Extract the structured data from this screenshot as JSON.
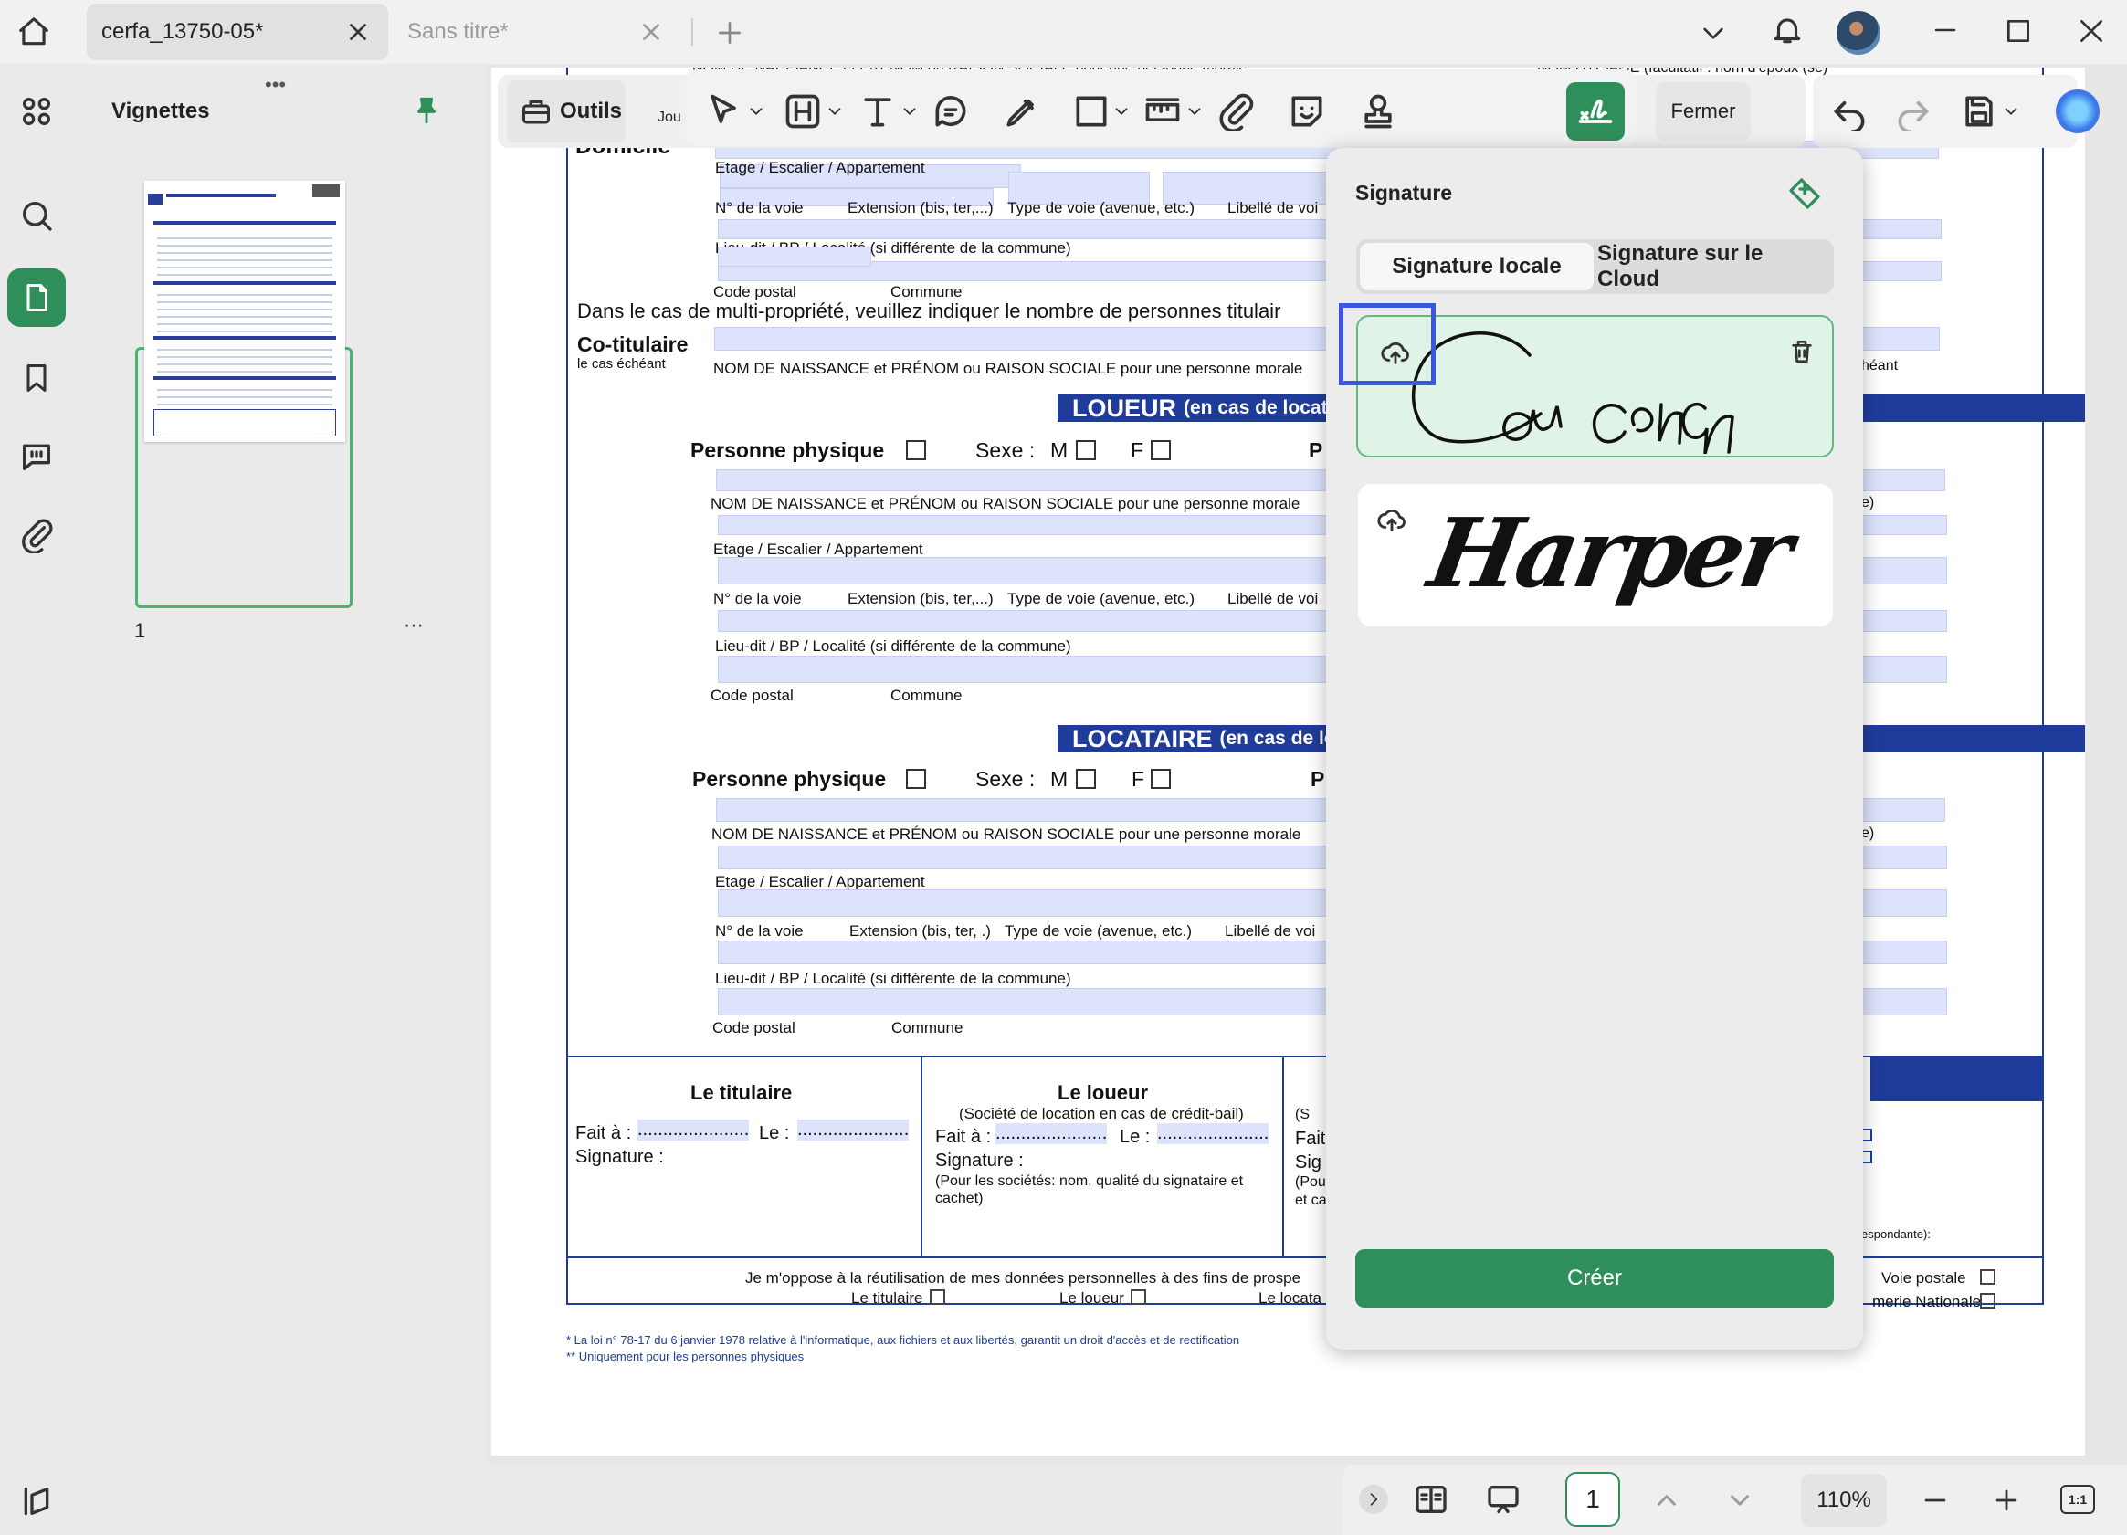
{
  "tabs": [
    {
      "label": "cerfa_13750-05*"
    },
    {
      "label": "Sans titre*"
    }
  ],
  "left_panel": {
    "title": "Vignettes",
    "page_number": "1"
  },
  "toolbar": {
    "tools_label": "Outils",
    "close_label": "Fermer",
    "hidden_word": "Jou"
  },
  "form": {
    "top_line_left": "NOM DE NAISSANCE et PRÉNOM ou RAISON SOCIALE pour une personne morale",
    "top_line_right": "NOM D'USAGE (facultatif : nom d'époux (se)",
    "domicile": "Domicile",
    "etage": "Etage / Escalier / Appartement",
    "num_voie": "N° de la voie",
    "extension": "Extension (bis, ter,...)",
    "extension_b": "Extension (bis, ter, .)",
    "type_voie": "Type de voie (avenue, etc.)",
    "libelle": "Libellé de voi",
    "lieu_dit": "Lieu-dit / BP / Localité (si différente de la commune)",
    "code_postal": "Code postal",
    "commune": "Commune",
    "multi": "Dans le cas de multi-propriété, veuillez indiquer le nombre de personnes titulair",
    "cotitulaire": "Co-titulaire",
    "cas_echeant": "le cas échéant",
    "nom_naissance": "NOM DE NAISSANCE et PRÉNOM ou RAISON SOCIALE pour une personne morale",
    "heant": "héant",
    "e_paren": "e)",
    "loueur_title": "LOUEUR",
    "loueur_sub": "(en cas de location ou crédit-bail)",
    "locataire_title": "LOCATAIRE",
    "locataire_sub": "(en cas de location longue durée ou crédit-bail)",
    "personne_physique": "Personne physique",
    "sexe": "Sexe :",
    "m": "M",
    "f": "F",
    "p": "P",
    "le_titulaire": "Le titulaire",
    "fait_a": "Fait à :",
    "dots1": "......................",
    "le": "Le :",
    "dots2": "......................",
    "signature": "Signature :",
    "le_loueur": "Le loueur",
    "societe_location": "(Société de location en cas de crédit-bail)",
    "pour_societes": "(Pour les sociétés: nom, qualité du signataire  et cachet)",
    "cut_s": "(S",
    "cut_fait": "Fait",
    "cut_sig": "Sig",
    "cut_pou": "(Pou",
    "cut_etc": "et ca",
    "espondante": "espondante):",
    "oppose": "Je m'oppose à la réutilisation de mes données personnelles à des fins de prospe",
    "opt_titulaire": "Le titulaire",
    "opt_loueur": "Le loueur",
    "opt_locataire": "Le locata",
    "voie_postale": "Voie postale",
    "gendarmerie": "merie Nationale",
    "footnote1": "* La loi n° 78-17 du 6 janvier 1978 relative à l'informatique, aux fichiers et aux libertés, garantit un droit d'accès et de rectification",
    "footnote2": "** Uniquement pour les personnes physiques"
  },
  "signature_panel": {
    "title": "Signature",
    "tab_local": "Signature locale",
    "tab_cloud": "Signature sur le Cloud",
    "signature1": "Coucou",
    "signature2": "Harper",
    "create_button": "Créer"
  },
  "bottom_bar": {
    "page_input": "1",
    "zoom": "110%",
    "ratio": "1:1"
  },
  "colors": {
    "accent_green": "#2f8f5b",
    "form_blue": "#1f3c9b",
    "field_fill": "#dde3fb",
    "highlight_box": "#3a55e0"
  }
}
